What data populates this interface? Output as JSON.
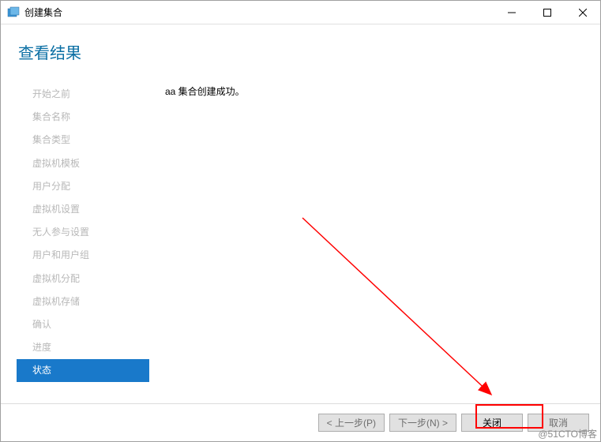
{
  "window": {
    "title": "创建集合"
  },
  "page": {
    "title": "查看结果"
  },
  "sidebar": {
    "items": [
      {
        "label": "开始之前",
        "active": false
      },
      {
        "label": "集合名称",
        "active": false
      },
      {
        "label": "集合类型",
        "active": false
      },
      {
        "label": "虚拟机模板",
        "active": false
      },
      {
        "label": "用户分配",
        "active": false
      },
      {
        "label": "虚拟机设置",
        "active": false
      },
      {
        "label": "无人参与设置",
        "active": false
      },
      {
        "label": "用户和用户组",
        "active": false
      },
      {
        "label": "虚拟机分配",
        "active": false
      },
      {
        "label": "虚拟机存储",
        "active": false
      },
      {
        "label": "确认",
        "active": false
      },
      {
        "label": "进度",
        "active": false
      },
      {
        "label": "状态",
        "active": true
      }
    ]
  },
  "main": {
    "status_message": "aa 集合创建成功。"
  },
  "footer": {
    "prev_label": "< 上一步(P)",
    "next_label": "下一步(N) >",
    "close_label": "关闭",
    "cancel_label": "取消"
  },
  "watermark": "@51CTO博客",
  "colors": {
    "accent": "#1979ca",
    "title": "#0b6fa4",
    "callout": "#ff0000"
  }
}
